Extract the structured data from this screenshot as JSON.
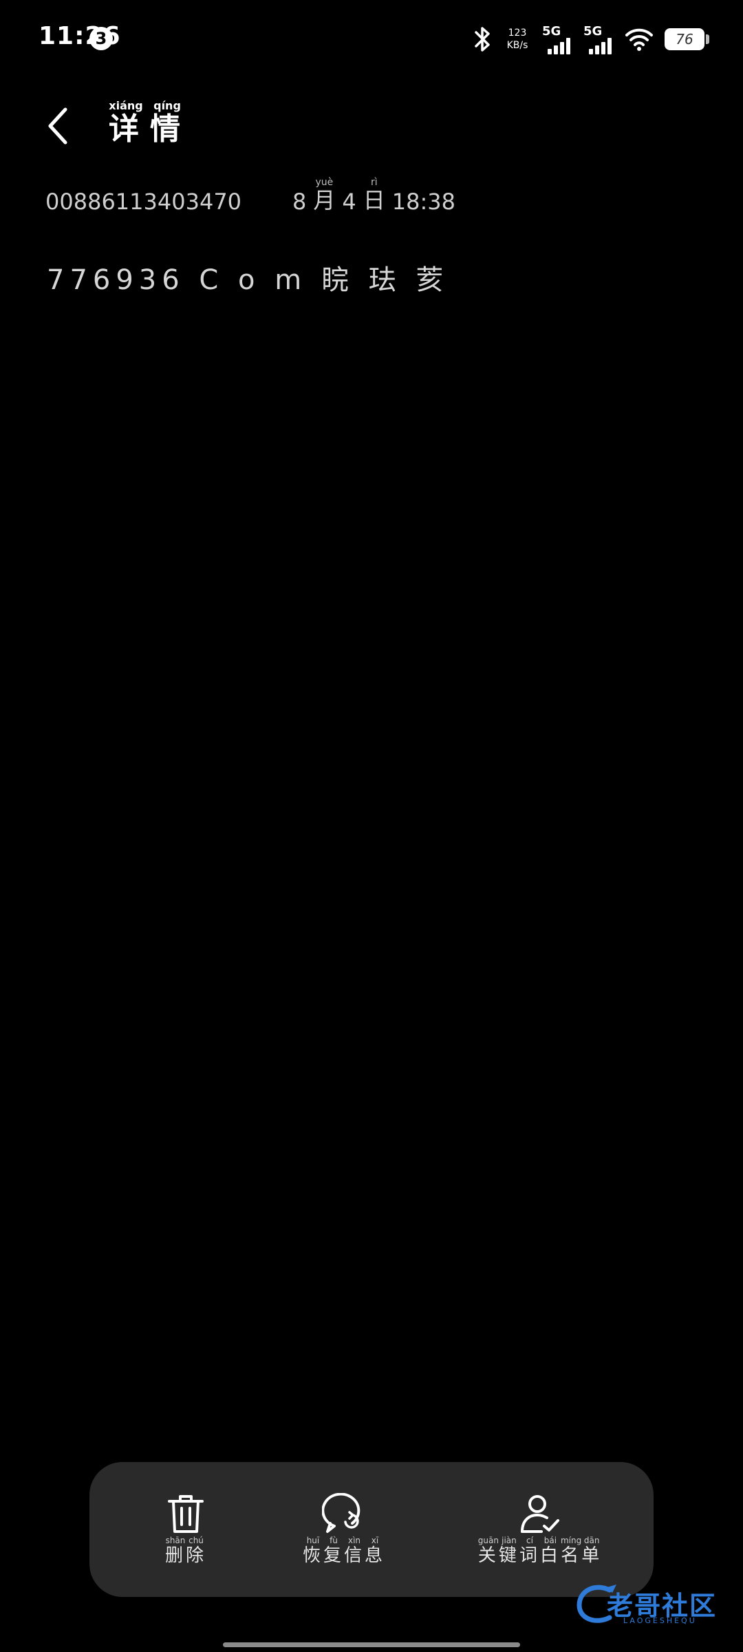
{
  "status_bar": {
    "time": "11:26",
    "notification_count": "3",
    "network_speed_value": "123",
    "network_speed_unit": "KB/s",
    "sim1_generation": "5G",
    "sim2_generation": "5G",
    "battery_level": "76",
    "icons": [
      "bluetooth-icon",
      "signal-icon",
      "wifi-icon",
      "battery-icon"
    ]
  },
  "header": {
    "back_icon": "chevron-left-icon",
    "title_chars": [
      {
        "char": "详",
        "pinyin": "xiáng"
      },
      {
        "char": "情",
        "pinyin": "qíng"
      }
    ]
  },
  "message": {
    "sender": "00886113403470",
    "date_month": "8",
    "date_month_char": "月",
    "date_month_pinyin": "yuè",
    "date_day": "4",
    "date_day_char": "日",
    "date_day_pinyin": "rì",
    "date_time": "18:38",
    "body": "776936 C o m 睆 珐 荄"
  },
  "actions": {
    "delete": {
      "icon": "trash-icon",
      "chars": [
        {
          "char": "删",
          "pinyin": "shān"
        },
        {
          "char": "除",
          "pinyin": "chú"
        }
      ]
    },
    "restore": {
      "icon": "message-restore-icon",
      "chars": [
        {
          "char": "恢",
          "pinyin": "huī"
        },
        {
          "char": "复",
          "pinyin": "fù"
        },
        {
          "char": "信",
          "pinyin": "xìn"
        },
        {
          "char": "息",
          "pinyin": "xī"
        }
      ]
    },
    "whitelist": {
      "icon": "user-check-icon",
      "chars": [
        {
          "char": "关",
          "pinyin": "guān"
        },
        {
          "char": "键",
          "pinyin": "jiàn"
        },
        {
          "char": "词",
          "pinyin": "cí"
        },
        {
          "char": "白",
          "pinyin": "bái"
        },
        {
          "char": "名",
          "pinyin": "míng"
        },
        {
          "char": "单",
          "pinyin": "dān"
        }
      ]
    }
  },
  "watermark": {
    "text": "老哥社区",
    "subtext": "LAOGESHEQU",
    "color": "#2f7bd9"
  },
  "colors": {
    "background": "#000000",
    "action_bar": "#2a2a2a",
    "text_primary": "#ffffff",
    "text_secondary": "#cfcfcf"
  }
}
